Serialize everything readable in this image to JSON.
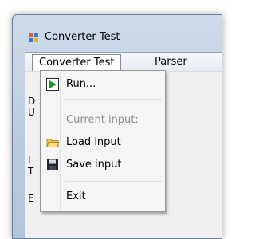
{
  "window": {
    "title": "Converter Test"
  },
  "menubar": {
    "items": [
      {
        "label": "Converter Test"
      },
      {
        "label": "Parser"
      }
    ]
  },
  "background_text": [
    "D",
    "U",
    "I",
    "T",
    "E"
  ],
  "dropdown": {
    "items": [
      {
        "label": "Run...",
        "icon": "run-icon",
        "enabled": true
      },
      {
        "label": "Current input:",
        "enabled": false
      },
      {
        "label": "Load input",
        "icon": "folder-icon",
        "enabled": true
      },
      {
        "label": "Save input",
        "icon": "floppy-disk-icon",
        "enabled": true
      },
      {
        "label": "Exit",
        "enabled": true
      }
    ]
  },
  "colors": {
    "run_icon": "#1b9b2a",
    "folder_icon": "#f2c64a",
    "disabled_text": "#8d8d8d"
  }
}
